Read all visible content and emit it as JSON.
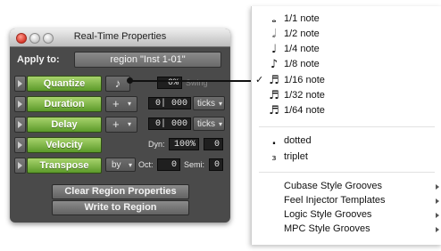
{
  "window": {
    "title": "Real-Time Properties"
  },
  "apply_to": {
    "label": "Apply to:",
    "value": "region \"Inst 1-01\""
  },
  "rows": {
    "quantize": {
      "label": "Quantize",
      "note_glyph": "♪",
      "value": "0%",
      "extra_label": "Swing"
    },
    "duration": {
      "label": "Duration",
      "op": "+",
      "value": "0| 000",
      "unit": "ticks"
    },
    "delay": {
      "label": "Delay",
      "op": "+",
      "value": "0| 000",
      "unit": "ticks"
    },
    "velocity": {
      "label": "Velocity",
      "dyn_label": "Dyn:",
      "dyn_value": "100%",
      "offset_value": "0"
    },
    "transpose": {
      "label": "Transpose",
      "mode": "by",
      "oct_label": "Oct:",
      "oct_value": "0",
      "semi_label": "Semi:",
      "semi_value": "0"
    }
  },
  "buttons": {
    "clear": "Clear Region Properties",
    "write": "Write to Region"
  },
  "menu": {
    "notes": [
      {
        "label": "1/1 note",
        "glyph": "𝅝",
        "icon": "whole-note-icon"
      },
      {
        "label": "1/2 note",
        "glyph": "𝅗𝅥",
        "icon": "half-note-icon"
      },
      {
        "label": "1/4 note",
        "glyph": "♩",
        "icon": "quarter-note-icon"
      },
      {
        "label": "1/8 note",
        "glyph": "♪",
        "icon": "eighth-note-icon"
      },
      {
        "label": "1/16 note",
        "glyph": "♬",
        "icon": "sixteenth-note-icon",
        "checked": true,
        "check": "✓"
      },
      {
        "label": "1/32 note",
        "glyph": "♬",
        "icon": "thirty-second-note-icon"
      },
      {
        "label": "1/64 note",
        "glyph": "♬",
        "icon": "sixty-fourth-note-icon"
      }
    ],
    "modifiers": [
      {
        "label": "dotted",
        "glyph": "."
      },
      {
        "label": "triplet",
        "glyph": "₃"
      }
    ],
    "grooves": [
      {
        "label": "Cubase Style Grooves"
      },
      {
        "label": "Feel Injector Templates"
      },
      {
        "label": "Logic Style Grooves"
      },
      {
        "label": "MPC Style Grooves"
      }
    ]
  },
  "colors": {
    "accent_green": "#7cb342",
    "panel": "#4a4a4a",
    "field": "#1f1f1f"
  }
}
